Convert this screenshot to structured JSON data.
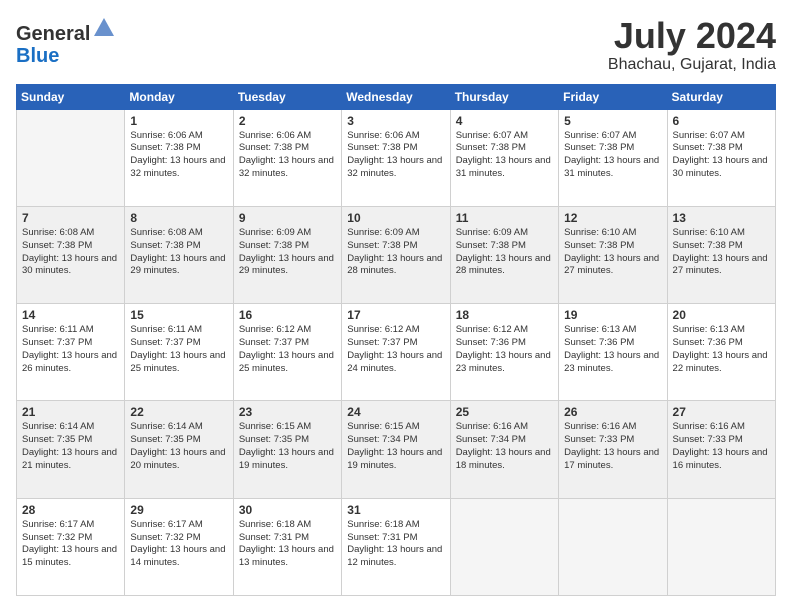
{
  "logo": {
    "line1": "General",
    "line2": "Blue"
  },
  "header": {
    "month": "July 2024",
    "location": "Bhachau, Gujarat, India"
  },
  "weekdays": [
    "Sunday",
    "Monday",
    "Tuesday",
    "Wednesday",
    "Thursday",
    "Friday",
    "Saturday"
  ],
  "weeks": [
    [
      {
        "day": "",
        "sunrise": "",
        "sunset": "",
        "daylight": ""
      },
      {
        "day": "1",
        "sunrise": "Sunrise: 6:06 AM",
        "sunset": "Sunset: 7:38 PM",
        "daylight": "Daylight: 13 hours and 32 minutes."
      },
      {
        "day": "2",
        "sunrise": "Sunrise: 6:06 AM",
        "sunset": "Sunset: 7:38 PM",
        "daylight": "Daylight: 13 hours and 32 minutes."
      },
      {
        "day": "3",
        "sunrise": "Sunrise: 6:06 AM",
        "sunset": "Sunset: 7:38 PM",
        "daylight": "Daylight: 13 hours and 32 minutes."
      },
      {
        "day": "4",
        "sunrise": "Sunrise: 6:07 AM",
        "sunset": "Sunset: 7:38 PM",
        "daylight": "Daylight: 13 hours and 31 minutes."
      },
      {
        "day": "5",
        "sunrise": "Sunrise: 6:07 AM",
        "sunset": "Sunset: 7:38 PM",
        "daylight": "Daylight: 13 hours and 31 minutes."
      },
      {
        "day": "6",
        "sunrise": "Sunrise: 6:07 AM",
        "sunset": "Sunset: 7:38 PM",
        "daylight": "Daylight: 13 hours and 30 minutes."
      }
    ],
    [
      {
        "day": "7",
        "sunrise": "Sunrise: 6:08 AM",
        "sunset": "Sunset: 7:38 PM",
        "daylight": "Daylight: 13 hours and 30 minutes."
      },
      {
        "day": "8",
        "sunrise": "Sunrise: 6:08 AM",
        "sunset": "Sunset: 7:38 PM",
        "daylight": "Daylight: 13 hours and 29 minutes."
      },
      {
        "day": "9",
        "sunrise": "Sunrise: 6:09 AM",
        "sunset": "Sunset: 7:38 PM",
        "daylight": "Daylight: 13 hours and 29 minutes."
      },
      {
        "day": "10",
        "sunrise": "Sunrise: 6:09 AM",
        "sunset": "Sunset: 7:38 PM",
        "daylight": "Daylight: 13 hours and 28 minutes."
      },
      {
        "day": "11",
        "sunrise": "Sunrise: 6:09 AM",
        "sunset": "Sunset: 7:38 PM",
        "daylight": "Daylight: 13 hours and 28 minutes."
      },
      {
        "day": "12",
        "sunrise": "Sunrise: 6:10 AM",
        "sunset": "Sunset: 7:38 PM",
        "daylight": "Daylight: 13 hours and 27 minutes."
      },
      {
        "day": "13",
        "sunrise": "Sunrise: 6:10 AM",
        "sunset": "Sunset: 7:38 PM",
        "daylight": "Daylight: 13 hours and 27 minutes."
      }
    ],
    [
      {
        "day": "14",
        "sunrise": "Sunrise: 6:11 AM",
        "sunset": "Sunset: 7:37 PM",
        "daylight": "Daylight: 13 hours and 26 minutes."
      },
      {
        "day": "15",
        "sunrise": "Sunrise: 6:11 AM",
        "sunset": "Sunset: 7:37 PM",
        "daylight": "Daylight: 13 hours and 25 minutes."
      },
      {
        "day": "16",
        "sunrise": "Sunrise: 6:12 AM",
        "sunset": "Sunset: 7:37 PM",
        "daylight": "Daylight: 13 hours and 25 minutes."
      },
      {
        "day": "17",
        "sunrise": "Sunrise: 6:12 AM",
        "sunset": "Sunset: 7:37 PM",
        "daylight": "Daylight: 13 hours and 24 minutes."
      },
      {
        "day": "18",
        "sunrise": "Sunrise: 6:12 AM",
        "sunset": "Sunset: 7:36 PM",
        "daylight": "Daylight: 13 hours and 23 minutes."
      },
      {
        "day": "19",
        "sunrise": "Sunrise: 6:13 AM",
        "sunset": "Sunset: 7:36 PM",
        "daylight": "Daylight: 13 hours and 23 minutes."
      },
      {
        "day": "20",
        "sunrise": "Sunrise: 6:13 AM",
        "sunset": "Sunset: 7:36 PM",
        "daylight": "Daylight: 13 hours and 22 minutes."
      }
    ],
    [
      {
        "day": "21",
        "sunrise": "Sunrise: 6:14 AM",
        "sunset": "Sunset: 7:35 PM",
        "daylight": "Daylight: 13 hours and 21 minutes."
      },
      {
        "day": "22",
        "sunrise": "Sunrise: 6:14 AM",
        "sunset": "Sunset: 7:35 PM",
        "daylight": "Daylight: 13 hours and 20 minutes."
      },
      {
        "day": "23",
        "sunrise": "Sunrise: 6:15 AM",
        "sunset": "Sunset: 7:35 PM",
        "daylight": "Daylight: 13 hours and 19 minutes."
      },
      {
        "day": "24",
        "sunrise": "Sunrise: 6:15 AM",
        "sunset": "Sunset: 7:34 PM",
        "daylight": "Daylight: 13 hours and 19 minutes."
      },
      {
        "day": "25",
        "sunrise": "Sunrise: 6:16 AM",
        "sunset": "Sunset: 7:34 PM",
        "daylight": "Daylight: 13 hours and 18 minutes."
      },
      {
        "day": "26",
        "sunrise": "Sunrise: 6:16 AM",
        "sunset": "Sunset: 7:33 PM",
        "daylight": "Daylight: 13 hours and 17 minutes."
      },
      {
        "day": "27",
        "sunrise": "Sunrise: 6:16 AM",
        "sunset": "Sunset: 7:33 PM",
        "daylight": "Daylight: 13 hours and 16 minutes."
      }
    ],
    [
      {
        "day": "28",
        "sunrise": "Sunrise: 6:17 AM",
        "sunset": "Sunset: 7:32 PM",
        "daylight": "Daylight: 13 hours and 15 minutes."
      },
      {
        "day": "29",
        "sunrise": "Sunrise: 6:17 AM",
        "sunset": "Sunset: 7:32 PM",
        "daylight": "Daylight: 13 hours and 14 minutes."
      },
      {
        "day": "30",
        "sunrise": "Sunrise: 6:18 AM",
        "sunset": "Sunset: 7:31 PM",
        "daylight": "Daylight: 13 hours and 13 minutes."
      },
      {
        "day": "31",
        "sunrise": "Sunrise: 6:18 AM",
        "sunset": "Sunset: 7:31 PM",
        "daylight": "Daylight: 13 hours and 12 minutes."
      },
      {
        "day": "",
        "sunrise": "",
        "sunset": "",
        "daylight": ""
      },
      {
        "day": "",
        "sunrise": "",
        "sunset": "",
        "daylight": ""
      },
      {
        "day": "",
        "sunrise": "",
        "sunset": "",
        "daylight": ""
      }
    ]
  ]
}
